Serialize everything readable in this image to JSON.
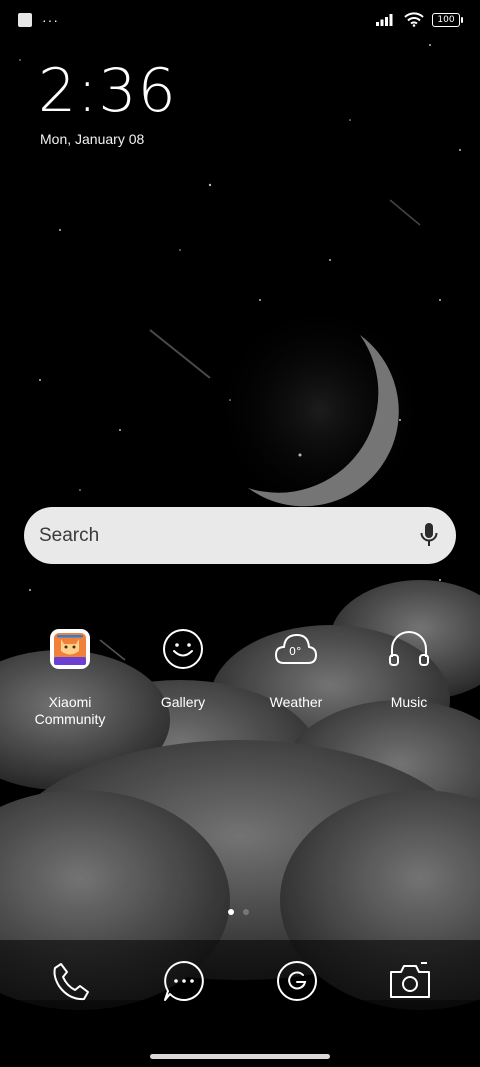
{
  "status_bar": {
    "more_indicator": "···",
    "battery_level": "100"
  },
  "lock": {
    "time": "2:36",
    "date": "Mon, January 08"
  },
  "search": {
    "placeholder": "Search"
  },
  "apps": [
    {
      "label": "Xiaomi\nCommunity",
      "icon": "xiaomi-community-icon"
    },
    {
      "label": "Gallery",
      "icon": "gallery-smiley-icon"
    },
    {
      "label": "Weather",
      "icon": "weather-cloud-icon",
      "temperature_badge": "0°"
    },
    {
      "label": "Music",
      "icon": "headphones-icon"
    }
  ],
  "pages": {
    "current": 1,
    "total": 2
  },
  "dock": [
    {
      "icon": "phone-icon"
    },
    {
      "icon": "messages-icon"
    },
    {
      "icon": "browser-g-icon"
    },
    {
      "icon": "camera-icon"
    }
  ],
  "colors": {
    "background": "#000000",
    "search_bar": "#e9e9e9",
    "icon_stroke": "#ffffff"
  }
}
